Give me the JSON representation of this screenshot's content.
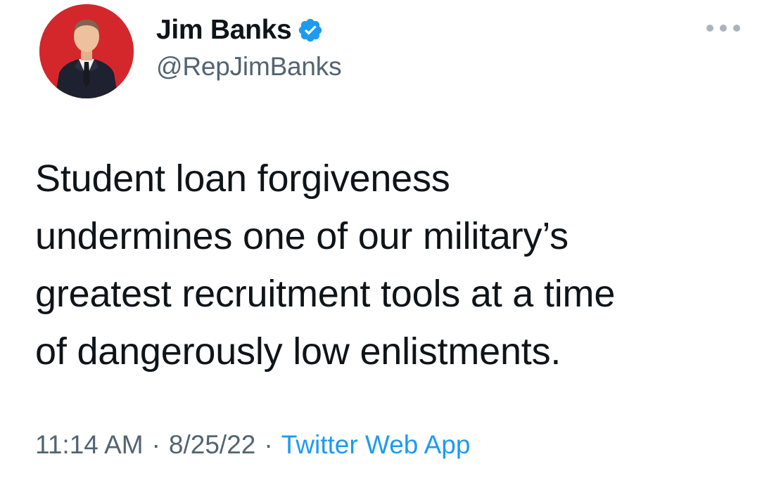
{
  "author": {
    "display_name": "Jim Banks",
    "handle": "@RepJimBanks",
    "verified": true,
    "avatar_icon": "profile-photo",
    "avatar_bg_color": "#d4272c"
  },
  "tweet": {
    "text": "Student loan forgiveness\nundermines one of our military’s\ngreatest recruitment tools at a time\nof dangerously low enlistments."
  },
  "meta": {
    "time": "11:14 AM",
    "separator": "·",
    "date": "8/25/22",
    "source": "Twitter Web App"
  },
  "menu": {
    "icon": "more-options-icon"
  },
  "colors": {
    "verified_blue": "#1d9bf0",
    "source_link": "#1d9bf0",
    "secondary_text": "#536471"
  }
}
